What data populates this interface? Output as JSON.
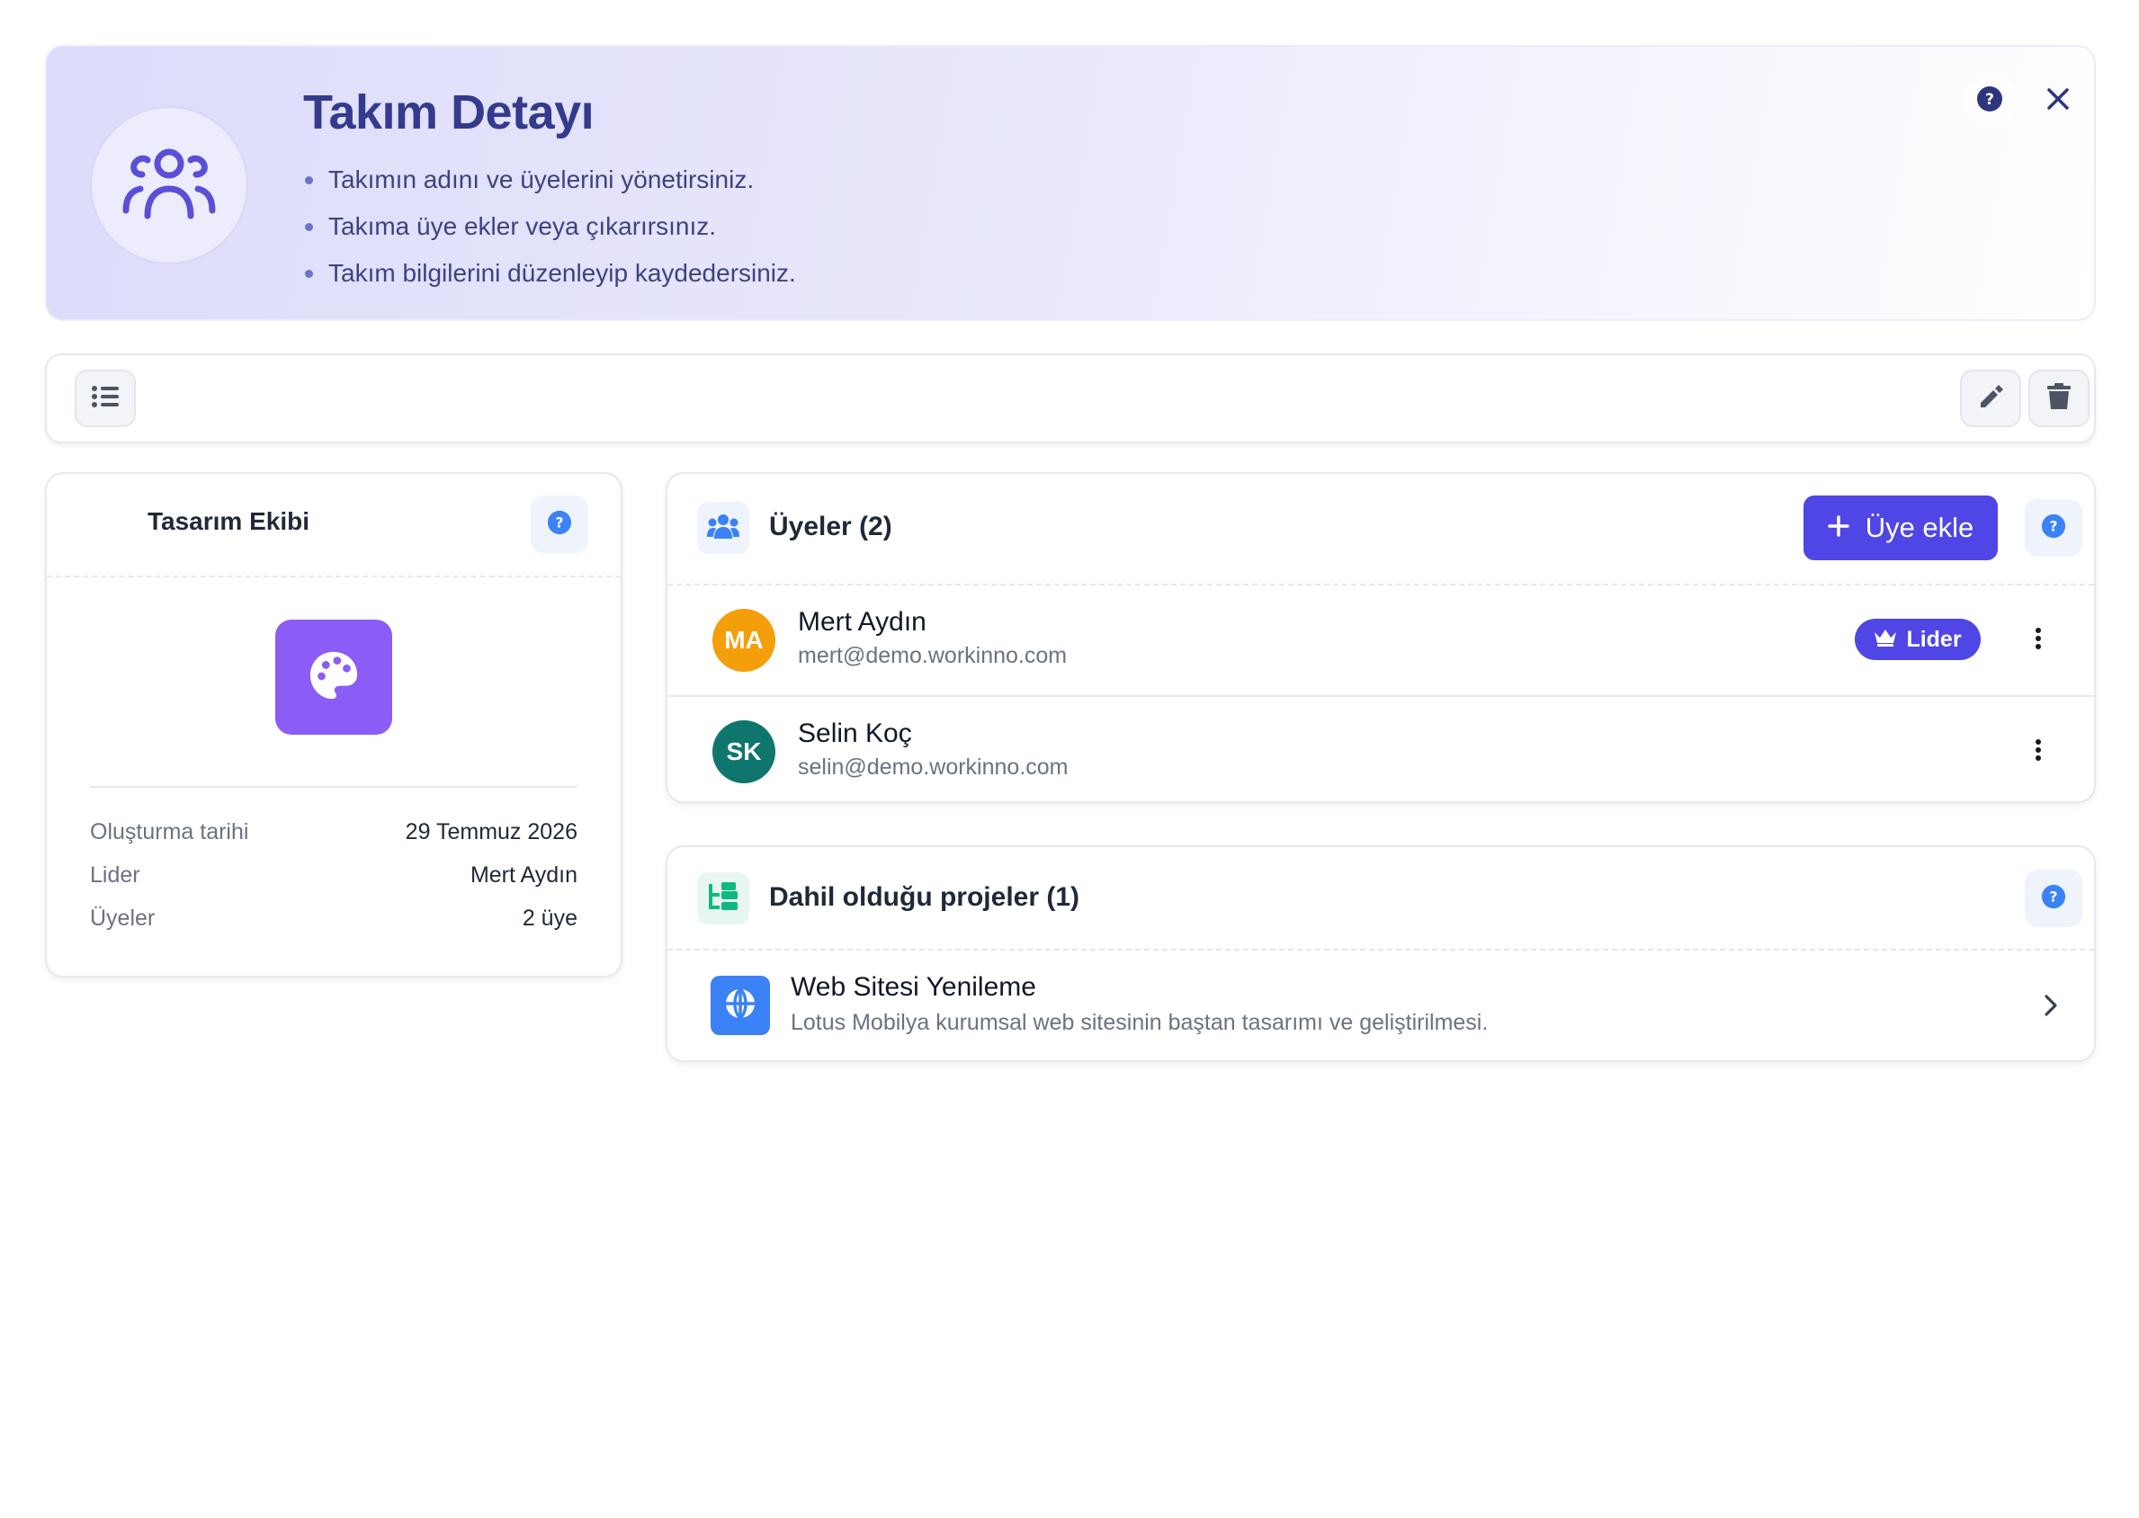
{
  "header": {
    "title": "Takım Detayı",
    "bullets": [
      "Takımın adını ve üyelerini yönetirsiniz.",
      "Takıma üye ekler veya çıkarırsınız.",
      "Takım bilgilerini düzenleyip kaydedersiniz."
    ],
    "icon": "users-icon",
    "help_icon": "help-icon",
    "close_icon": "close-icon"
  },
  "toolbar": {
    "list_icon": "list-icon",
    "edit_icon": "pencil-icon",
    "delete_icon": "trash-icon"
  },
  "team": {
    "name": "Tasarım Ekibi",
    "icon": "palette-icon",
    "icon_color": "#8b5cf6",
    "info": [
      {
        "label": "Oluşturma tarihi",
        "value": "29 Temmuz 2026"
      },
      {
        "label": "Lider",
        "value": "Mert Aydın"
      },
      {
        "label": "Üyeler",
        "value": "2 üye"
      }
    ]
  },
  "members": {
    "title": "Üyeler (2)",
    "add_label": "Üye ekle",
    "list": [
      {
        "initials": "MA",
        "name": "Mert Aydın",
        "email": "mert@demo.workinno.com",
        "badge": "Lider",
        "avatar_color": "#f59e0b"
      },
      {
        "initials": "SK",
        "name": "Selin Koç",
        "email": "selin@demo.workinno.com",
        "avatar_color": "#0f766e"
      }
    ]
  },
  "projects": {
    "title": "Dahil olduğu projeler (1)",
    "list": [
      {
        "name": "Web Sitesi Yenileme",
        "description": "Lotus Mobilya kurumsal web sitesinin baştan tasarımı ve geliştirilmesi.",
        "icon": "globe-icon"
      }
    ]
  },
  "colors": {
    "accent": "#4f46e5",
    "header_title": "#343b8c",
    "help_blue": "#3b82f6"
  }
}
